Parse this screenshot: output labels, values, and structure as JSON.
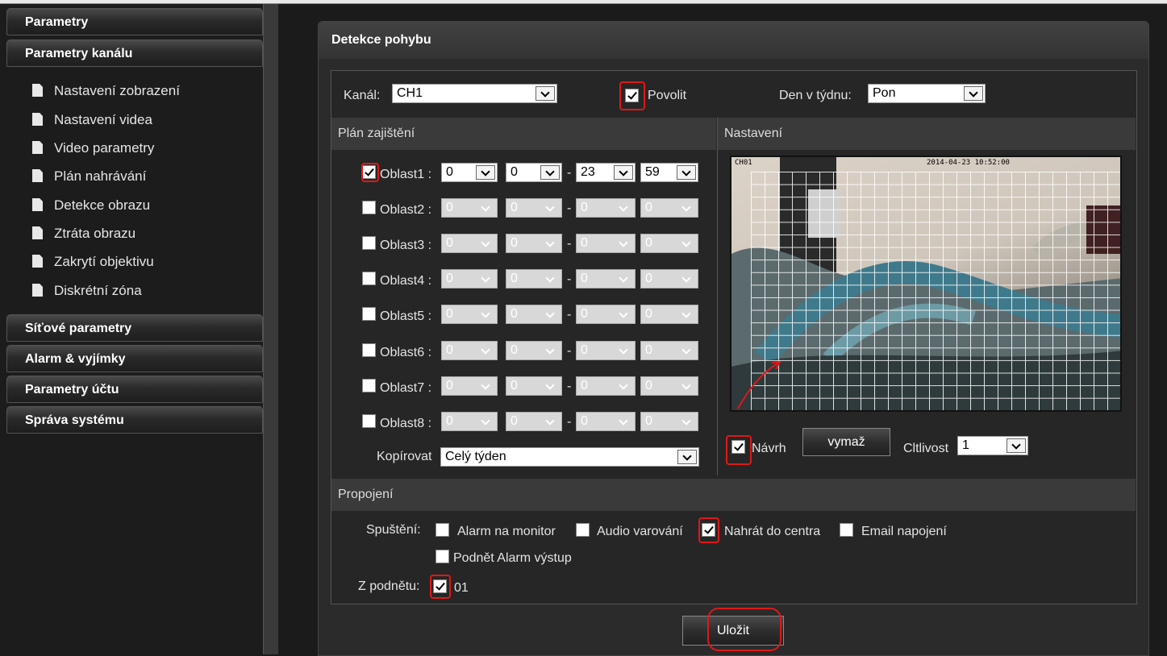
{
  "sidebar": {
    "sections": [
      {
        "label": "Parametry"
      },
      {
        "label": "Parametry kanálu"
      },
      {
        "label": "Síťové parametry"
      },
      {
        "label": "Alarm & vyjímky"
      },
      {
        "label": "Parametry účtu"
      },
      {
        "label": "Správa systému"
      }
    ],
    "items": [
      {
        "label": "Nastavení zobrazení",
        "icon": "document-icon"
      },
      {
        "label": "Nastavení videa",
        "icon": "document-icon"
      },
      {
        "label": "Video parametry",
        "icon": "document-icon"
      },
      {
        "label": "Plán nahrávání",
        "icon": "document-icon"
      },
      {
        "label": "Detekce obrazu",
        "icon": "document-icon"
      },
      {
        "label": "Ztráta obrazu",
        "icon": "document-icon"
      },
      {
        "label": "Zakrytí objektivu",
        "icon": "document-icon"
      },
      {
        "label": "Diskrétní zóna",
        "icon": "document-icon"
      }
    ]
  },
  "panel": {
    "title": "Detekce pohybu",
    "channel_label": "Kanál:",
    "channel_value": "CH1",
    "enable_label": "Povolit",
    "enable_checked": true,
    "day_label": "Den v týdnu:",
    "day_value": "Pon"
  },
  "schedule": {
    "header": "Plán zajištění",
    "areas": [
      {
        "label": "Oblast1 :",
        "checked": true,
        "h1": "0",
        "m1": "0",
        "h2": "23",
        "m2": "59"
      },
      {
        "label": "Oblast2 :",
        "checked": false,
        "h1": "0",
        "m1": "0",
        "h2": "0",
        "m2": "0"
      },
      {
        "label": "Oblast3 :",
        "checked": false,
        "h1": "0",
        "m1": "0",
        "h2": "0",
        "m2": "0"
      },
      {
        "label": "Oblast4 :",
        "checked": false,
        "h1": "0",
        "m1": "0",
        "h2": "0",
        "m2": "0"
      },
      {
        "label": "Oblast5 :",
        "checked": false,
        "h1": "0",
        "m1": "0",
        "h2": "0",
        "m2": "0"
      },
      {
        "label": "Oblast6 :",
        "checked": false,
        "h1": "0",
        "m1": "0",
        "h2": "0",
        "m2": "0"
      },
      {
        "label": "Oblast7 :",
        "checked": false,
        "h1": "0",
        "m1": "0",
        "h2": "0",
        "m2": "0"
      },
      {
        "label": "Oblast8 :",
        "checked": false,
        "h1": "0",
        "m1": "0",
        "h2": "0",
        "m2": "0"
      }
    ],
    "dash": "-",
    "copy_label": "Kopírovat",
    "copy_value": "Celý týden"
  },
  "settings": {
    "header": "Nastavení",
    "osd_channel": "CH01",
    "osd_datetime": "2014-04-23 10:52:00",
    "draw_label": "Návrh",
    "draw_checked": true,
    "clear_button": "vymaž",
    "sensitivity_label": "Cltlivost",
    "sensitivity_value": "1"
  },
  "linkage": {
    "header": "Propojení",
    "trigger_label": "Spuštění:",
    "options": [
      {
        "label": "Alarm na monitor",
        "checked": false
      },
      {
        "label": "Audio varování",
        "checked": false
      },
      {
        "label": "Nahrát do centra",
        "checked": true
      },
      {
        "label": "Email napojení",
        "checked": false
      },
      {
        "label": "Podnět Alarm výstup",
        "checked": false
      }
    ],
    "from_trigger_label": "Z podnětu:",
    "from_trigger_value": "01",
    "from_trigger_checked": true
  },
  "save_button": "Uložit",
  "colors": {
    "highlight": "#e01818",
    "background": "#1b1b1b",
    "panel": "#2b2b2b"
  }
}
